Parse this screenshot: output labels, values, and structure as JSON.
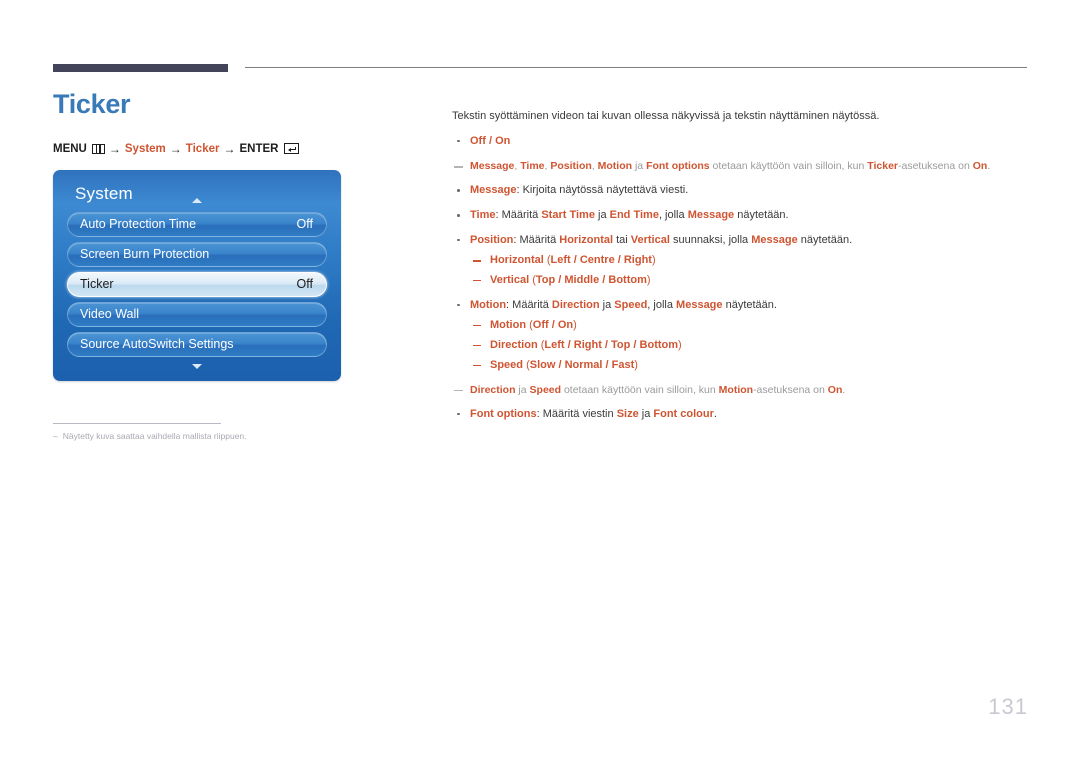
{
  "document": {
    "page_number": "131",
    "title": "Ticker",
    "title_color": "#3879b8",
    "accent_color": "#cf5532",
    "rule_color": "#43435a"
  },
  "menu_path": {
    "menu_label": "MENU",
    "menu_icon": "menu-grid-icon",
    "arrow": "→",
    "step_system": "System",
    "step_ticker": "Ticker",
    "enter_label": "ENTER",
    "enter_icon": "enter-return-icon"
  },
  "osd": {
    "panel_title": "System",
    "caret_up_icon": "caret-up-icon",
    "caret_down_icon": "caret-down-icon",
    "rows": [
      {
        "label": "Auto Protection Time",
        "value": "Off",
        "selected": false
      },
      {
        "label": "Screen Burn Protection",
        "value": "",
        "selected": false
      },
      {
        "label": "Ticker",
        "value": "Off",
        "selected": true
      },
      {
        "label": "Video Wall",
        "value": "",
        "selected": false
      },
      {
        "label": "Source AutoSwitch Settings",
        "value": "",
        "selected": false
      }
    ]
  },
  "footnote": {
    "dash": "–",
    "text": "Näytetty kuva saattaa vaihdella mallista riippuen."
  },
  "content": {
    "intro": "Tekstin syöttäminen videon tai kuvan ollessa näkyvissä ja tekstin näyttäminen näytössä.",
    "b1": {
      "off": "Off",
      "slash": " / ",
      "on": "On"
    },
    "note1": {
      "t1": "Message",
      "t2": ", ",
      "t3": "Time",
      "t4": ", ",
      "t5": "Position",
      "t6": ", ",
      "t7": "Motion",
      "t8": " ja ",
      "t9": "Font options",
      "t10": " otetaan käyttöön vain silloin, kun ",
      "t11": "Ticker",
      "t12": "-asetuksena on ",
      "t13": "On",
      "t14": "."
    },
    "b2": {
      "term": "Message",
      "rest": ": Kirjoita näytössä näytettävä viesti."
    },
    "b3": {
      "term": "Time",
      "t1": ": Määritä ",
      "t2": "Start Time",
      "t3": " ja ",
      "t4": "End Time",
      "t5": ", jolla ",
      "t6": "Message",
      "t7": " näytetään."
    },
    "b4": {
      "term": "Position",
      "t1": ": Määritä ",
      "t2": "Horizontal",
      "t3": " tai ",
      "t4": "Vertical",
      "t5": " suunnaksi, jolla ",
      "t6": "Message",
      "t7": " näytetään.",
      "sub1": {
        "term": "Horizontal",
        "open": " (",
        "opts": "Left / Centre / Right",
        "close": ")"
      },
      "sub2": {
        "term": "Vertical",
        "open": " (",
        "opts": "Top / Middle / Bottom",
        "close": ")"
      }
    },
    "b5": {
      "term": "Motion",
      "t1": ": Määritä ",
      "t2": "Direction",
      "t3": " ja ",
      "t4": "Speed",
      "t5": ", jolla ",
      "t6": "Message",
      "t7": " näytetään.",
      "sub1": {
        "term": "Motion",
        "open": " (",
        "opts": "Off / On",
        "close": ")"
      },
      "sub2": {
        "term": "Direction",
        "open": " (",
        "opts": "Left / Right / Top / Bottom",
        "close": ")"
      },
      "sub3": {
        "term": "Speed",
        "open": " (",
        "opts": "Slow / Normal / Fast",
        "close": ")"
      }
    },
    "note2": {
      "t1": "Direction",
      "t2": " ja ",
      "t3": "Speed",
      "t4": " otetaan käyttöön vain silloin, kun ",
      "t5": "Motion",
      "t6": "-asetuksena on ",
      "t7": "On",
      "t8": "."
    },
    "b6": {
      "term": "Font options",
      "t1": ": Määritä viestin ",
      "t2": "Size",
      "t3": " ja ",
      "t4": "Font colour",
      "t5": "."
    }
  }
}
